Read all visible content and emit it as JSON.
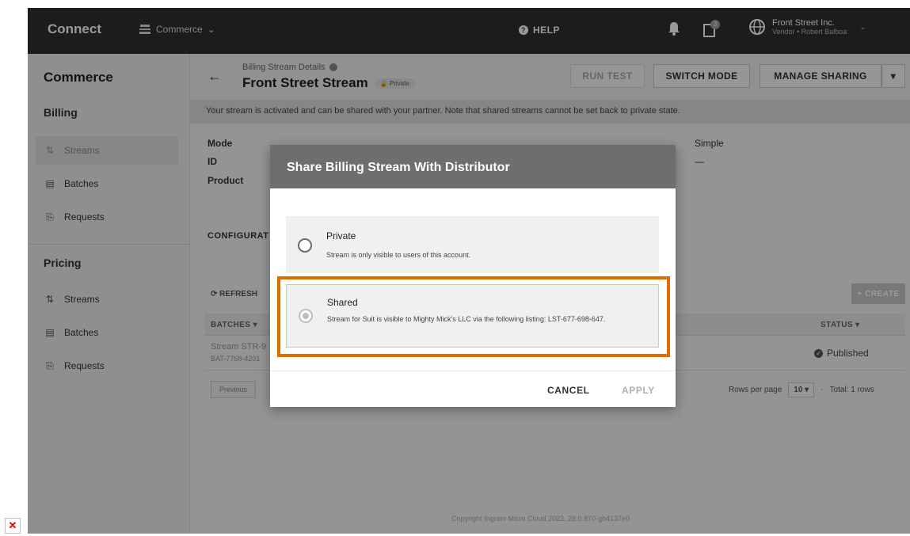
{
  "topbar": {
    "brand": "Connect",
    "app_switcher": "Commerce",
    "help": "HELP",
    "notifications_count": "3",
    "account_name": "Front Street Inc.",
    "account_sub": "Vendor • Robert Balboa"
  },
  "sidebar": {
    "title": "Commerce",
    "sections": [
      {
        "label": "Billing",
        "items": [
          "Streams",
          "Batches",
          "Requests"
        ]
      },
      {
        "label": "Pricing",
        "items": [
          "Streams",
          "Batches",
          "Requests"
        ]
      }
    ]
  },
  "header": {
    "breadcrumb": "Billing Stream Details",
    "title": "Front Street Stream",
    "visibility_chip": "Private",
    "run_test": "RUN TEST",
    "switch_mode": "SWITCH MODE",
    "manage_sharing": "MANAGE SHARING"
  },
  "info_bar": "Your stream is activated and can be shared with your partner. Note that shared streams cannot be set back to private state.",
  "details": {
    "mode_label": "Mode",
    "id_label": "ID",
    "product_label": "Product",
    "type_value": "Simple",
    "id_right_value": "—"
  },
  "config_label": "CONFIGURAT",
  "table": {
    "refresh": "REFRESH",
    "create": "+ CREATE",
    "col_batches": "BATCHES",
    "col_status": "STATUS",
    "row": {
      "name": "Stream STR-9",
      "id": "BAT-7768-4201",
      "status": "Published"
    },
    "previous": "Previous",
    "rows_per_page_label": "Rows per page",
    "rows_per_page": "10",
    "total": "Total: 1 rows"
  },
  "footer": "Copyright Ingram Micro Cloud 2023. 28.0.870-gb4137e0",
  "dialog": {
    "title": "Share Billing Stream With Distributor",
    "private_title": "Private",
    "private_desc": "Stream is only visible to users of this account.",
    "shared_title": "Shared",
    "shared_desc": "Stream for Suit is visible to Mighty Mick's LLC via the following listing: LST-677-698-647.",
    "cancel": "CANCEL",
    "apply": "APPLY"
  },
  "colors": {
    "topbar": "#2f2f2f",
    "highlight": "#e06c00",
    "dialog_header": "#6e6e6e"
  }
}
